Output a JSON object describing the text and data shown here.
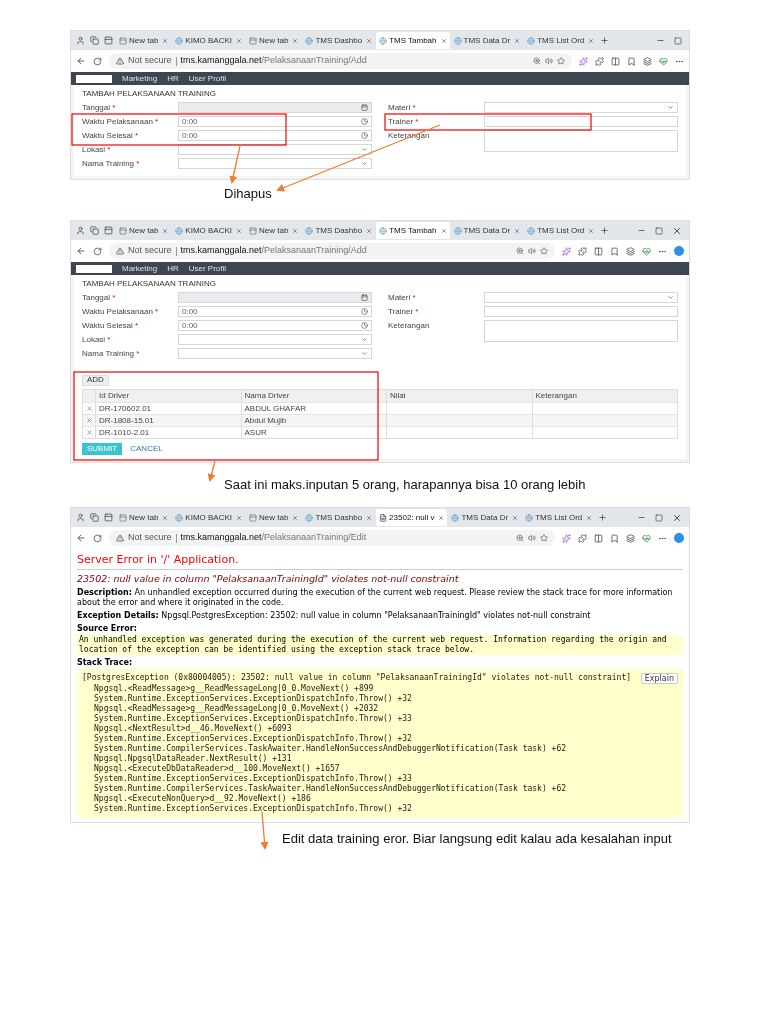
{
  "sections": [
    {
      "screenshot": {
        "browser": {
          "tabs": [
            {
              "label": "New tab",
              "kind": "newtab",
              "selected": false
            },
            {
              "label": "KIMO BACKI",
              "kind": "site",
              "selected": false
            },
            {
              "label": "New tab",
              "kind": "newtab",
              "selected": false
            },
            {
              "label": "TMS Dashbo",
              "kind": "site",
              "selected": false
            },
            {
              "label": "TMS Tambah",
              "kind": "site",
              "selected": true
            },
            {
              "label": "TMS Data Dr",
              "kind": "site",
              "selected": false
            },
            {
              "label": "TMS List Ord",
              "kind": "site",
              "selected": false
            }
          ],
          "show_close": false,
          "copilot": false,
          "address": {
            "security": "Not secure",
            "host": "tms.kamanggala.net",
            "path": "/PelaksanaanTraining/Add"
          }
        },
        "page": {
          "kind": "form",
          "nav": [
            "Marketing",
            "HR",
            "User Profil"
          ],
          "title": "TAMBAH PELAKSANAAN TRAINING",
          "left_fields": [
            {
              "label": "Tanggal",
              "required_mark": "*",
              "kind": "date"
            },
            {
              "label": "Waktu Pelaksanaan",
              "required_mark": "*",
              "kind": "time",
              "value": "0:00"
            },
            {
              "label": "Waktu Selesai",
              "required_mark": "*",
              "kind": "time",
              "value": "0:00"
            },
            {
              "label": "Lokasi",
              "required_mark": "*",
              "kind": "select"
            },
            {
              "label": "Nama Training",
              "required_mark": "*",
              "kind": "select"
            }
          ],
          "right_fields": [
            {
              "label": "Materi",
              "required_mark": "*",
              "kind": "select"
            },
            {
              "label": "Trainer",
              "required_mark": "*",
              "kind": "text"
            },
            {
              "label": "Keterangan",
              "kind": "textarea"
            }
          ]
        }
      },
      "caption": "Dihapus"
    },
    {
      "screenshot": {
        "browser": {
          "tabs": [
            {
              "label": "New tab",
              "kind": "newtab",
              "selected": false
            },
            {
              "label": "KIMO BACKI",
              "kind": "site",
              "selected": false
            },
            {
              "label": "New tab",
              "kind": "newtab",
              "selected": false
            },
            {
              "label": "TMS Dashbo",
              "kind": "site",
              "selected": false
            },
            {
              "label": "TMS Tambah",
              "kind": "site",
              "selected": true
            },
            {
              "label": "TMS Data Dr",
              "kind": "site",
              "selected": false
            },
            {
              "label": "TMS List Ord",
              "kind": "site",
              "selected": false
            }
          ],
          "show_close": true,
          "copilot": true,
          "address": {
            "security": "Not secure",
            "host": "tms.kamanggala.net",
            "path": "/PelaksanaanTraining/Add"
          }
        },
        "page": {
          "kind": "form",
          "nav": [
            "Marketing",
            "HR",
            "User Profil"
          ],
          "title": "TAMBAH PELAKSANAAN TRAINING",
          "left_fields": [
            {
              "label": "Tanggal",
              "required_mark": "*",
              "kind": "date"
            },
            {
              "label": "Waktu Pelaksanaan",
              "required_mark": "*",
              "kind": "time",
              "value": "0:00"
            },
            {
              "label": "Waktu Selesai",
              "required_mark": "*",
              "kind": "time",
              "value": "0:00"
            },
            {
              "label": "Lokasi",
              "required_mark": "*",
              "kind": "select"
            },
            {
              "label": "Nama Training",
              "required_mark": "*",
              "kind": "select"
            }
          ],
          "right_fields": [
            {
              "label": "Materi",
              "required_mark": "*",
              "kind": "select"
            },
            {
              "label": "Trainer",
              "required_mark": "*",
              "kind": "text"
            },
            {
              "label": "Keterangan",
              "kind": "textarea"
            }
          ],
          "table": {
            "add_button": "ADD",
            "columns": [
              "Id Driver",
              "Nama Driver",
              "Nilai",
              "Keterangan"
            ],
            "rows": [
              {
                "cells": [
                  "DR-170602.01",
                  "ABDUL GHAFAR"
                ]
              },
              {
                "cells": [
                  "DR-1808-15.01",
                  "Abdul Mujib"
                ]
              },
              {
                "cells": [
                  "DR-1010-2.01",
                  "ASUR"
                ]
              }
            ]
          },
          "submit": "SUBMIT",
          "cancel": "CANCEL"
        }
      },
      "caption": "Saat ini maks.inputan 5 orang, harapannya bisa 10 orang lebih"
    },
    {
      "screenshot": {
        "browser": {
          "tabs": [
            {
              "label": "New tab",
              "kind": "newtab",
              "selected": false
            },
            {
              "label": "KIMO BACKI",
              "kind": "site",
              "selected": false
            },
            {
              "label": "New tab",
              "kind": "newtab",
              "selected": false
            },
            {
              "label": "TMS Dashbo",
              "kind": "site",
              "selected": false
            },
            {
              "label": "23502: null v",
              "kind": "document",
              "selected": true
            },
            {
              "label": "TMS Data Dr",
              "kind": "site",
              "selected": false
            },
            {
              "label": "TMS List Ord",
              "kind": "site",
              "selected": false
            }
          ],
          "show_close": true,
          "copilot": true,
          "address": {
            "security": "Not secure",
            "host": "tms.kamanggala.net",
            "path": "/PelaksanaanTraining/Edit"
          }
        },
        "page": {
          "kind": "error",
          "title": "Server Error in '/' Application.",
          "heading": "23502: null value in column \"PelaksanaanTrainingId\" violates not-null constraint",
          "description": {
            "label": "Description:",
            "text": "An unhandled exception occurred during the execution of the current web request. Please review the stack trace for more information about the error and where it originated in the code."
          },
          "exception": {
            "label": "Exception Details:",
            "text": "Npgsql.PostgresException: 23502: null value in column \"PelaksanaanTrainingId\" violates not-null constraint"
          },
          "source_label": "Source Error:",
          "source_note": "An unhandled exception was generated during the execution of the current web request. Information regarding the origin and location of the exception can be identified using the exception stack trace below.",
          "stack_label": "Stack Trace:",
          "explain": "Explain",
          "stack_header": "[PostgresException (0x80004005): 23502: null value in column \"PelaksanaanTrainingId\" violates not-null constraint]",
          "stack_frames": [
            "Npgsql.<ReadMessage>g__ReadMessageLong|0_0.MoveNext() +899",
            "System.Runtime.ExceptionServices.ExceptionDispatchInfo.Throw() +32",
            "Npgsql.<ReadMessage>g__ReadMessageLong|0_0.MoveNext() +2032",
            "System.Runtime.ExceptionServices.ExceptionDispatchInfo.Throw() +33",
            "Npgsql.<NextResult>d__46.MoveNext() +6093",
            "System.Runtime.ExceptionServices.ExceptionDispatchInfo.Throw() +32",
            "System.Runtime.CompilerServices.TaskAwaiter.HandleNonSuccessAndDebuggerNotification(Task task) +62",
            "Npgsql.NpgsqlDataReader.NextResult() +131",
            "Npgsql.<ExecuteDbDataReader>d__100.MoveNext() +1657",
            "System.Runtime.ExceptionServices.ExceptionDispatchInfo.Throw() +33",
            "System.Runtime.CompilerServices.TaskAwaiter.HandleNonSuccessAndDebuggerNotification(Task task) +62",
            "Npgsql.<ExecuteNonQuery>d__92.MoveNext() +186",
            "System.Runtime.ExceptionServices.ExceptionDispatchInfo.Throw() +32"
          ]
        }
      },
      "caption": "Edit data training eror. Biar langsung edit kalau ada kesalahan input"
    }
  ]
}
